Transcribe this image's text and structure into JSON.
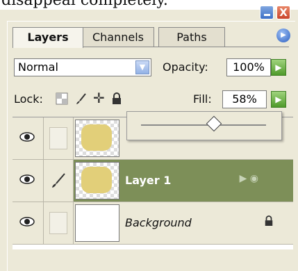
{
  "caption": "disappeal completely.",
  "window": {
    "minimize_label": "_",
    "close_label": "X"
  },
  "tabs": [
    {
      "label": "Layers",
      "active": true
    },
    {
      "label": "Channels",
      "active": false
    },
    {
      "label": "Paths",
      "active": false
    }
  ],
  "panel_menu_icon": "panel-menu-icon",
  "blend_mode": {
    "value": "Normal"
  },
  "opacity": {
    "label": "Opacity:",
    "value": "100%"
  },
  "lock": {
    "label": "Lock:",
    "icons": [
      "transparency-lock-icon",
      "brush-lock-icon",
      "move-lock-icon",
      "padlock-icon"
    ]
  },
  "fill": {
    "label": "Fill:",
    "value": "58%",
    "slider_fraction": 0.58
  },
  "layers": [
    {
      "name": "",
      "visible": true,
      "selected": false,
      "thumb": "yellow-blob"
    },
    {
      "name": "Layer 1",
      "visible": true,
      "selected": true,
      "thumb": "yellow-blob"
    },
    {
      "name": "Background",
      "visible": true,
      "selected": false,
      "thumb": "white",
      "locked": true
    }
  ],
  "colors": {
    "selected_row": "#7d8f58",
    "blob": "#e2cf79",
    "panel_bg": "#ece9d8"
  }
}
